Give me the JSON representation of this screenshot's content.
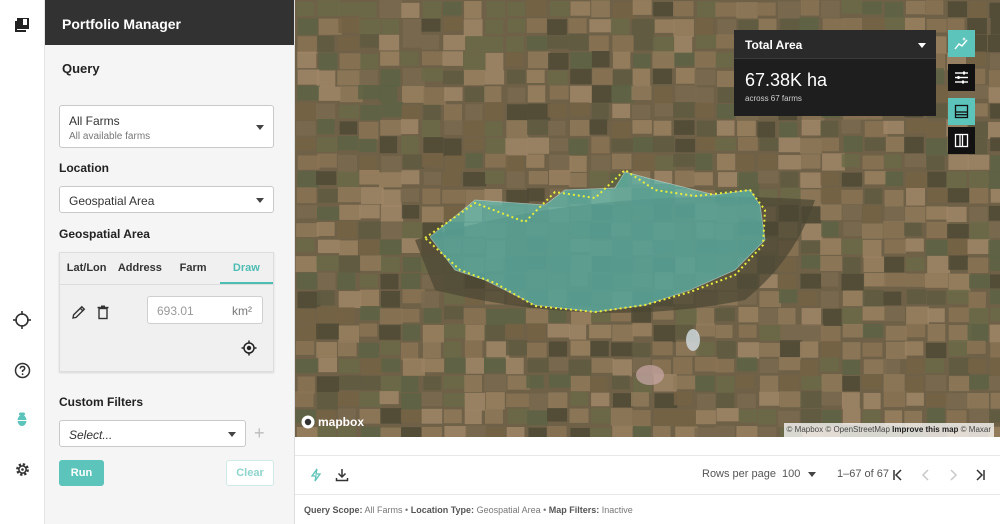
{
  "app": {
    "title": "Portfolio Manager"
  },
  "rail": {
    "icons": [
      "book-icon",
      "crosshair-icon",
      "help-icon",
      "bug-icon",
      "gear-icon"
    ]
  },
  "query": {
    "title": "Query",
    "farms": {
      "value": "All Farms",
      "sub": "All available farms"
    },
    "location": {
      "label": "Location",
      "value": "Geospatial Area"
    },
    "geospatial": {
      "label": "Geospatial Area",
      "tabs": [
        "Lat/Lon",
        "Address",
        "Farm",
        "Draw"
      ],
      "active_tab": "Draw",
      "area_placeholder": "693.01",
      "area_unit": "km²"
    },
    "custom_filters": {
      "label": "Custom Filters",
      "placeholder": "Select...",
      "add": "+"
    },
    "run_label": "Run",
    "clear_label": "Clear"
  },
  "map": {
    "total_area": {
      "title": "Total Area",
      "value": "67.38K ha",
      "sub": "across 67 farms"
    },
    "logo_text": "mapbox",
    "attribution": {
      "mapbox": "© Mapbox",
      "osm": "© OpenStreetMap",
      "improve": "Improve this map",
      "maxar": "© Maxar"
    },
    "accent_color": "#5cc4bb",
    "polygon_color": "#e8ef3a"
  },
  "table": {
    "rows_per_page_label": "Rows per page",
    "rows_per_page": "100",
    "range": "1–67 of 67"
  },
  "summary": {
    "scope_label": "Query Scope:",
    "scope": "All Farms",
    "loc_label": "Location Type:",
    "loc": "Geospatial Area",
    "filters_label": "Map Filters:",
    "filters": "Inactive"
  }
}
